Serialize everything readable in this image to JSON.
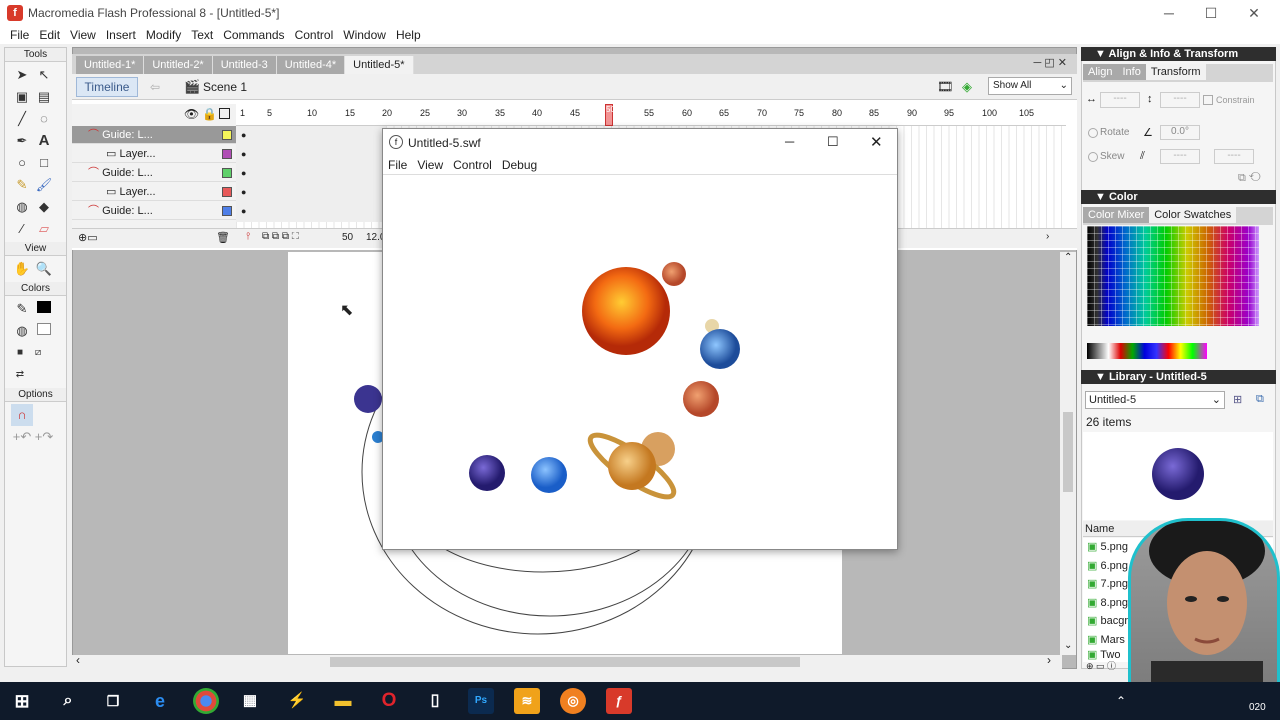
{
  "app": {
    "logo": "f",
    "title": "Macromedia Flash Professional 8 - [Untitled-5*]"
  },
  "menu": [
    "File",
    "Edit",
    "View",
    "Insert",
    "Modify",
    "Text",
    "Commands",
    "Control",
    "Window",
    "Help"
  ],
  "tools": {
    "tools_label": "Tools",
    "view_label": "View",
    "colors_label": "Colors",
    "options_label": "Options"
  },
  "doc_tabs": [
    "Untitled-1*",
    "Untitled-2*",
    "Untitled-3",
    "Untitled-4*",
    "Untitled-5*"
  ],
  "timeline": {
    "button": "Timeline",
    "scene": "Scene 1",
    "show_all": "Show All",
    "ruler": [
      "1",
      "5",
      "10",
      "15",
      "20",
      "25",
      "30",
      "35",
      "40",
      "45",
      "50",
      "55",
      "60",
      "65",
      "70",
      "75",
      "80",
      "85",
      "90",
      "95",
      "100",
      "105"
    ],
    "layers": [
      {
        "name": "Guide: L...",
        "color": "#f5f55a",
        "selected": true
      },
      {
        "name": "Layer...",
        "color": "#b04fb5",
        "selected": false
      },
      {
        "name": "Guide: L...",
        "color": "#5fd06a",
        "selected": false
      },
      {
        "name": "Layer...",
        "color": "#e85a5a",
        "selected": false
      },
      {
        "name": "Guide: L...",
        "color": "#4f7fe8",
        "selected": false
      }
    ],
    "frame_num": "50",
    "fps": "12.0"
  },
  "swf": {
    "title": "Untitled-5.swf",
    "menu": [
      "File",
      "View",
      "Control",
      "Debug"
    ]
  },
  "panels": {
    "align_title": "Align & Info & Transform",
    "align_tabs": [
      "Align",
      "Info",
      "Transform"
    ],
    "constrain": "Constrain",
    "rotate": "Rotate",
    "skew": "Skew",
    "rotate_value": "0.0°",
    "color_title": "Color",
    "color_tabs": [
      "Color Mixer",
      "Color Swatches"
    ],
    "library_title": "Library - Untitled-5",
    "library_select": "Untitled-5",
    "items_count": "26 items",
    "name_header": "Name",
    "lib_items": [
      "5.png",
      "6.png",
      "7.png",
      "8.png",
      "bacground",
      "Mars",
      "Two"
    ]
  },
  "taskbar": {
    "time": "020"
  }
}
